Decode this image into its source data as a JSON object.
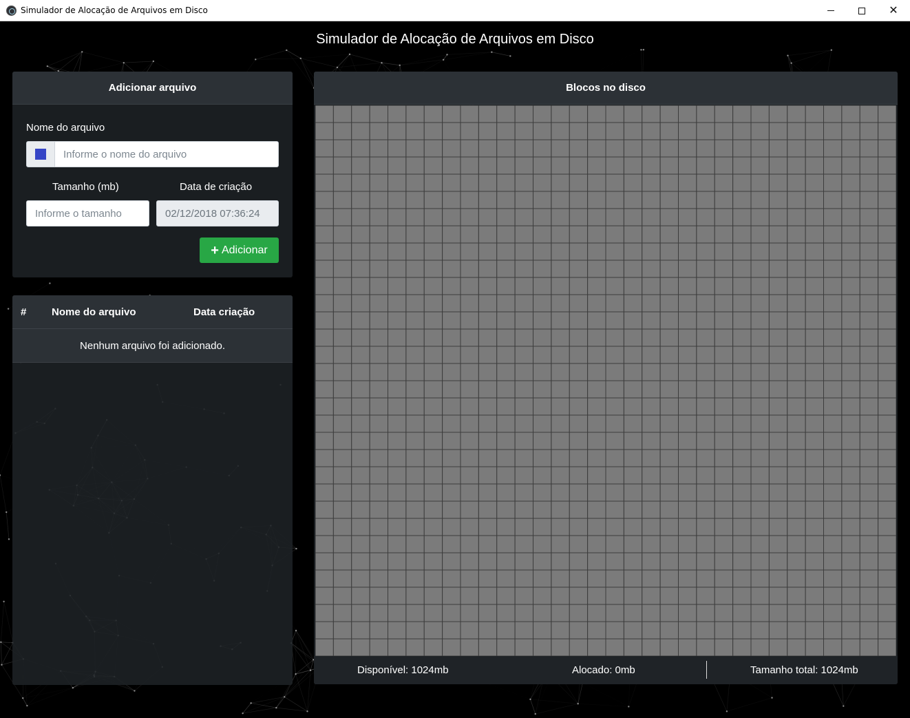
{
  "window": {
    "title": "Simulador de Alocação de Arquivos em Disco",
    "minimize_icon": "minimize-icon",
    "maximize_icon": "maximize-icon",
    "close_icon": "close-icon",
    "close_glyph": "✕"
  },
  "heading": "Simulador de Alocação de Arquivos em Disco",
  "add_panel": {
    "title": "Adicionar arquivo",
    "name_label": "Nome do arquivo",
    "name_placeholder": "Informe o nome do arquivo",
    "name_value": "",
    "color_value": "#3545c6",
    "size_label": "Tamanho (mb)",
    "size_placeholder": "Informe o tamanho",
    "size_value": "",
    "date_label": "Data de criação",
    "date_value": "02/12/2018 07:36:24",
    "add_button_label": "Adicionar",
    "add_button_icon": "plus-icon"
  },
  "file_table": {
    "columns": [
      "#",
      "Nome do arquivo",
      "Data criação"
    ],
    "empty_message": "Nenhum arquivo foi adicionado."
  },
  "disk": {
    "title": "Blocos no disco",
    "columns": 32,
    "rows": 32,
    "block_color": "#7b7b7b",
    "grid_line_color": "#3c3c3c",
    "available": "Disponível: 1024mb",
    "allocated": "Alocado: 0mb",
    "total": "Tamanho total: 1024mb"
  },
  "colors": {
    "background": "#000000",
    "panel": "#1e2226",
    "panel_header": "#2c3136",
    "accent_green": "#28a745"
  }
}
